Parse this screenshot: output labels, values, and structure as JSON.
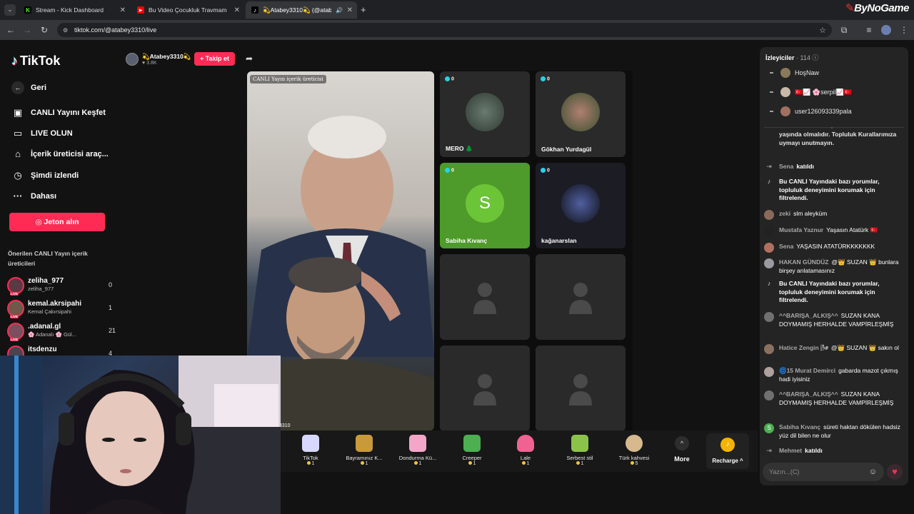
{
  "browser": {
    "tabs": [
      {
        "title": "Stream - Kick Dashboard",
        "icon": "kick-icon",
        "color": "#53fc18"
      },
      {
        "title": "Bu Video Çocukluk Travmamdır",
        "icon": "youtube-icon",
        "color": "#ff0000"
      },
      {
        "title": "💫Atabey3310💫 (@atabey",
        "icon": "tiktok-icon",
        "color": "#ffffff"
      }
    ],
    "url": "tiktok.com/@atabey3310/live",
    "watermark": "ByNoGame"
  },
  "sidebar": {
    "logo": "TikTok",
    "back": "Geri",
    "items": [
      {
        "label": "CANLI Yayını Keşfet",
        "icon": "live-tv-icon"
      },
      {
        "label": "LIVE OLUN",
        "icon": "camera-icon"
      },
      {
        "label": "İçerik üreticisi araç...",
        "icon": "creator-tools-icon"
      },
      {
        "label": "Şimdi izlendi",
        "icon": "history-icon"
      },
      {
        "label": "Dahası",
        "icon": "more-dots-icon"
      }
    ],
    "coins_button": "Jeton alın",
    "recommended_title": "Önerilen CANLI Yayın içerik üreticileri",
    "recommended": [
      {
        "name": "zeliha_977",
        "sub": "zeliha_977",
        "count": "0"
      },
      {
        "name": "kemal.akrsipahi",
        "sub": "Kemal Çakırsipahi",
        "count": "1"
      },
      {
        "name": ".adanal.gl",
        "sub": "🌸 Adanalı 🌸 Gül...",
        "count": "21"
      },
      {
        "name": "itsdenzu",
        "sub": "",
        "count": "4"
      }
    ]
  },
  "host": {
    "name": "💫Atabey3310💫",
    "likes": "3.8K",
    "follow": "+ Takip et"
  },
  "stage": {
    "main_badge": "CANLI Yayın içerik üreticisi",
    "main_caption": "3310",
    "guests": [
      {
        "name": "MERO 🌲",
        "count": "0",
        "color": "#3a3a3a"
      },
      {
        "name": "Gökhan Yurdagül",
        "count": "0",
        "color": "#3a3a3a"
      },
      {
        "name": "Sabiha Kıvanç",
        "count": "0",
        "color": "#4e9a2a",
        "initial": "S"
      },
      {
        "name": "kağanarslan",
        "count": "0",
        "color": "#1c1c24"
      }
    ]
  },
  "gifts": [
    {
      "label": "TikTok",
      "price": "1",
      "color": "#d8d8ff"
    },
    {
      "label": "Bayramınız K...",
      "price": "1",
      "color": "#c99a3a"
    },
    {
      "label": "Dondurma Kü...",
      "price": "1",
      "color": "#f4a6c8"
    },
    {
      "label": "Creeper",
      "price": "1",
      "color": "#4caf50"
    },
    {
      "label": "Lale",
      "price": "1",
      "color": "#f06292"
    },
    {
      "label": "Serbest stil",
      "price": "1",
      "color": "#8bc34a"
    },
    {
      "label": "Türk kahvesi",
      "price": "5",
      "color": "#d7b98e"
    }
  ],
  "gift_more": "More",
  "recharge": "Recharge",
  "chat": {
    "viewers_label": "İzleyiciler",
    "viewers_count": "· 114",
    "viewers": [
      "HoşNaw",
      "🇹🇷📈 🌸serpil📈🇹🇷",
      "user126093339pala"
    ],
    "messages": [
      {
        "type": "system",
        "text": "yaşında olmalıdır. Topluluk Kurallarımıza uymayı unutmayın."
      },
      {
        "type": "join",
        "user": "Sena",
        "text": "katıldı"
      },
      {
        "type": "system",
        "text": "Bu CANLI Yayındaki bazı yorumlar, topluluk deneyimini korumak için filtrelendi."
      },
      {
        "type": "chat",
        "user": "zeki",
        "text": "slm aleyküm"
      },
      {
        "type": "chat",
        "user": "Mustafa Yaznur",
        "text": "Yaşasın Atatürk 🇹🇷"
      },
      {
        "type": "chat",
        "user": "Sena",
        "text": "YAŞASIN ATATÜRKKKKKKK"
      },
      {
        "type": "chat",
        "user": "HAKAN GÜNDÜZ",
        "text": "@👑 SUZAN 👑 bunlara birşey anlatamasınız"
      },
      {
        "type": "system",
        "text": "Bu CANLI Yayındaki bazı yorumlar, topluluk deneyimini korumak için filtrelendi."
      },
      {
        "type": "chat",
        "user": "^^BARIŞA_ALKIŞ^^",
        "text": "SUZAN KANA DOYMAMIŞ HERHALDE VAMPİRLEŞMİŞ"
      },
      {
        "type": "chat",
        "user": "Hatice Zengin 🌬",
        "text": "@👑 SUZAN 👑 sakın ol"
      },
      {
        "type": "chat",
        "user": "🌀15 Murat Demirci",
        "text": "gabarda mazot çıkmış hadi iyisiniz"
      },
      {
        "type": "chat",
        "user": "^^BARIŞA_ALKIŞ^^",
        "text": "SUZAN KANA DOYMAMIŞ HERHALDE VAMPİRLEŞMİŞ"
      },
      {
        "type": "chat",
        "user": "Sabiha Kıvanç",
        "text": "süreti haktan dökülen hadsiz yüz dil bilen ne olur"
      },
      {
        "type": "join",
        "user": "Mehmet",
        "text": "katıldı"
      }
    ],
    "input_placeholder": "Yazın...(C)"
  }
}
